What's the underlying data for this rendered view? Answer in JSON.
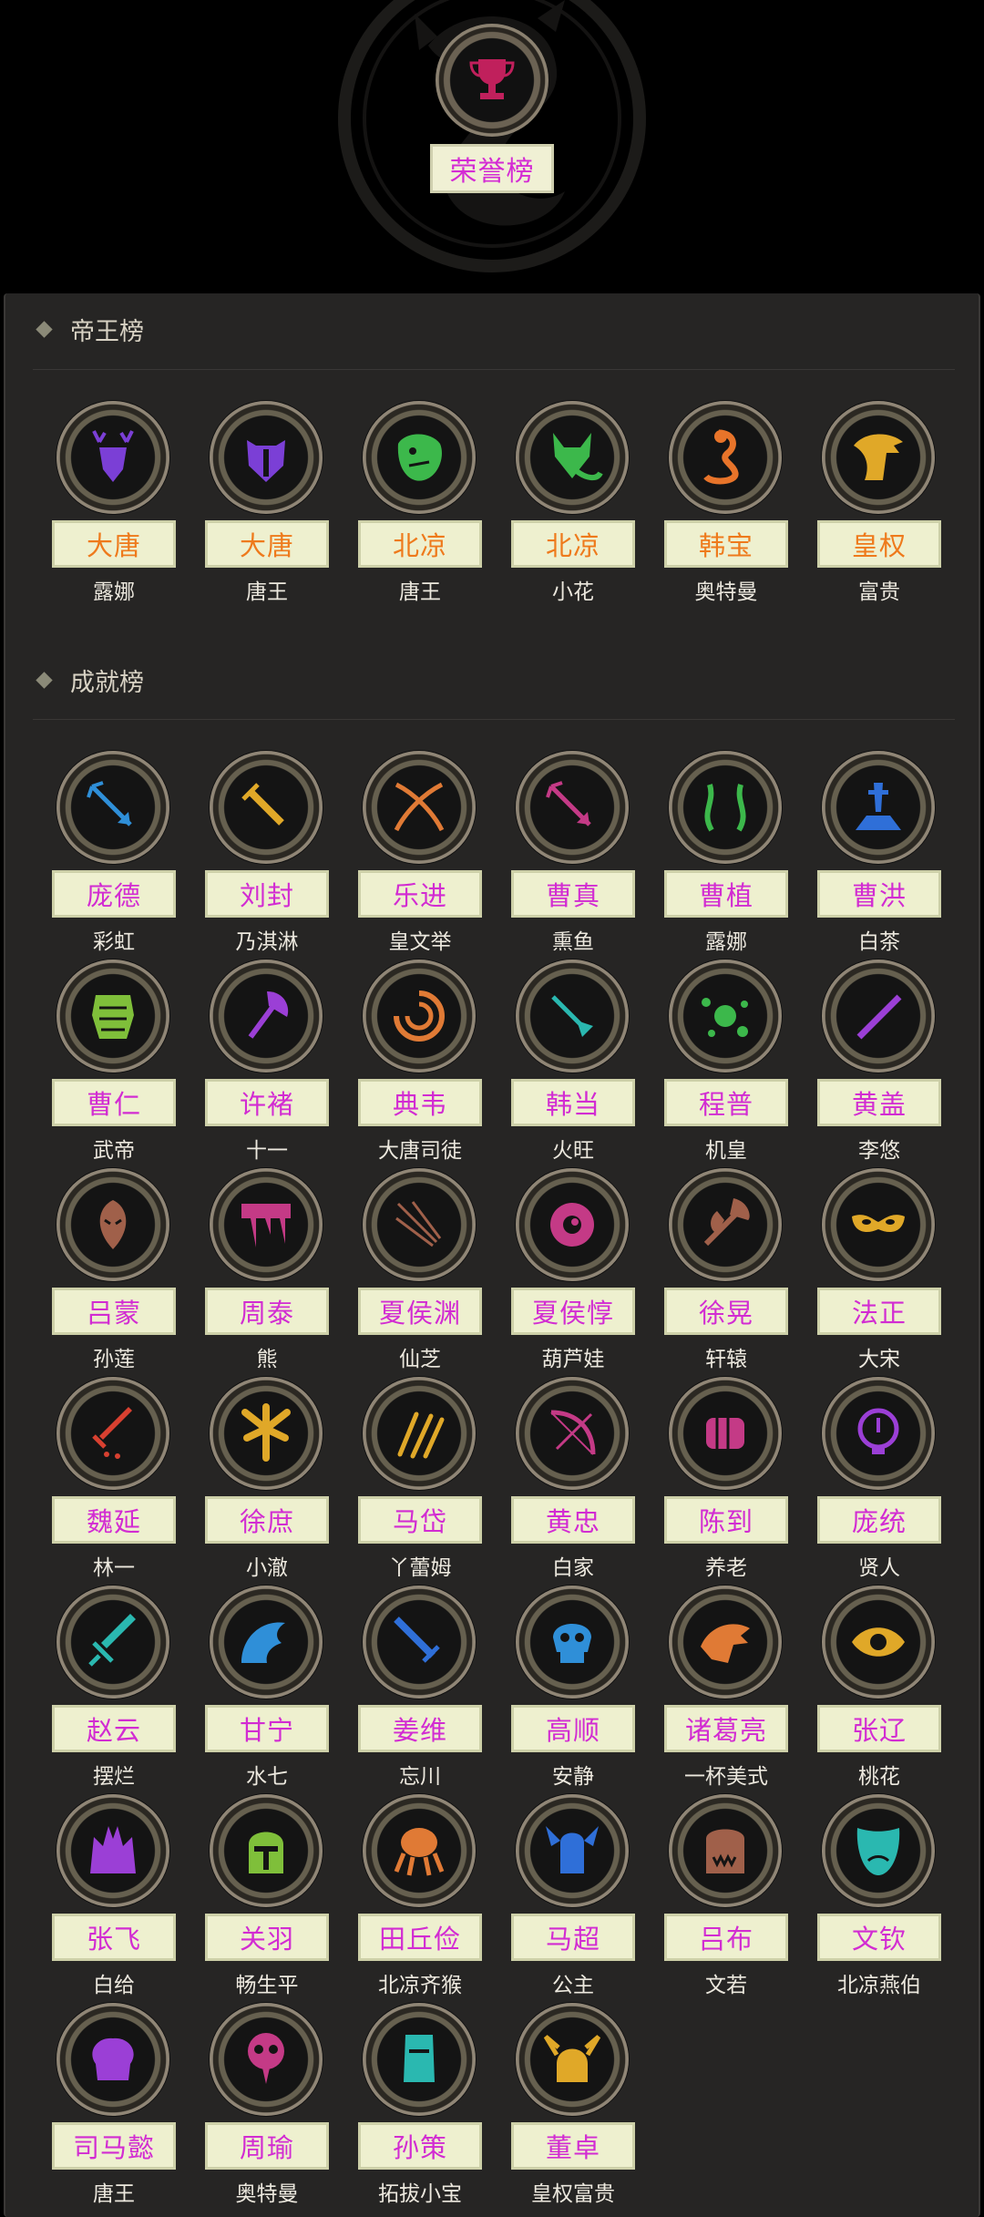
{
  "header": {
    "title": "荣誉榜",
    "icon": "trophy-icon",
    "accent": "#d42bd4"
  },
  "emperor": {
    "title": "帝王榜",
    "items": [
      {
        "faction": "大唐",
        "player": "露娜",
        "icon": "deer-icon",
        "color": "#7b3fd6"
      },
      {
        "faction": "大唐",
        "player": "唐王",
        "icon": "badger-icon",
        "color": "#7b3fd6"
      },
      {
        "faction": "北凉",
        "player": "唐王",
        "icon": "lizard-icon",
        "color": "#3cb84b"
      },
      {
        "faction": "北凉",
        "player": "小花",
        "icon": "fox-icon",
        "color": "#3cb84b"
      },
      {
        "faction": "韩宝",
        "player": "奥特曼",
        "icon": "cobra-icon",
        "color": "#e8742a"
      },
      {
        "faction": "皇权",
        "player": "富贵",
        "icon": "eagle-icon",
        "color": "#e0a828"
      }
    ]
  },
  "achievement": {
    "title": "成就榜",
    "items": [
      {
        "name": "庞德",
        "player": "彩虹",
        "icon": "arrow-icon",
        "color": "#2f8fd8"
      },
      {
        "name": "刘封",
        "player": "乃淇淋",
        "icon": "dagger-icon",
        "color": "#e0a828"
      },
      {
        "name": "乐进",
        "player": "皇文举",
        "icon": "crossed-scimitars-icon",
        "color": "#e07a35"
      },
      {
        "name": "曹真",
        "player": "熏鱼",
        "icon": "arrow-icon",
        "color": "#c43a86"
      },
      {
        "name": "曹植",
        "player": "露娜",
        "icon": "serpents-icon",
        "color": "#3cb84b"
      },
      {
        "name": "曹洪",
        "player": "白茶",
        "icon": "sword-in-stone-icon",
        "color": "#2f6fd8"
      },
      {
        "name": "曹仁",
        "player": "武帝",
        "icon": "armor-icon",
        "color": "#7fbf3a"
      },
      {
        "name": "许褚",
        "player": "十一",
        "icon": "axe-icon",
        "color": "#9b3fd6"
      },
      {
        "name": "典韦",
        "player": "大唐司徒",
        "icon": "vortex-icon",
        "color": "#e07a35"
      },
      {
        "name": "韩当",
        "player": "火旺",
        "icon": "shovel-icon",
        "color": "#2ab8b0"
      },
      {
        "name": "程普",
        "player": "机皇",
        "icon": "splash-icon",
        "color": "#3cb84b"
      },
      {
        "name": "黄盖",
        "player": "李悠",
        "icon": "staff-icon",
        "color": "#9b3fd6"
      },
      {
        "name": "吕蒙",
        "player": "孙莲",
        "icon": "mask-icon",
        "color": "#a0604a"
      },
      {
        "name": "周泰",
        "player": "熊",
        "icon": "drip-icon",
        "color": "#c43a86"
      },
      {
        "name": "夏侯渊",
        "player": "仙芝",
        "icon": "arrow-burst-icon",
        "color": "#a0604a"
      },
      {
        "name": "夏侯惇",
        "player": "葫芦娃",
        "icon": "eyeball-icon",
        "color": "#c43a86"
      },
      {
        "name": "徐晃",
        "player": "轩辕",
        "icon": "battle-axe-icon",
        "color": "#a0604a"
      },
      {
        "name": "法正",
        "player": "大宋",
        "icon": "carnival-mask-icon",
        "color": "#e0a828"
      },
      {
        "name": "魏延",
        "player": "林一",
        "icon": "bloody-sword-icon",
        "color": "#d84030"
      },
      {
        "name": "徐庶",
        "player": "小澈",
        "icon": "leaf-icon",
        "color": "#e0a828"
      },
      {
        "name": "马岱",
        "player": "丫蕾姆",
        "icon": "claws-icon",
        "color": "#e0a828"
      },
      {
        "name": "黄忠",
        "player": "白家",
        "icon": "bow-icon",
        "color": "#c43a86"
      },
      {
        "name": "陈到",
        "player": "养老",
        "icon": "fist-icon",
        "color": "#c43a86"
      },
      {
        "name": "庞统",
        "player": "贤人",
        "icon": "idea-icon",
        "color": "#9b3fd6"
      },
      {
        "name": "赵云",
        "player": "摆烂",
        "icon": "crystal-sword-icon",
        "color": "#2ab8b0"
      },
      {
        "name": "甘宁",
        "player": "水七",
        "icon": "wave-icon",
        "color": "#2f8fd8"
      },
      {
        "name": "姜维",
        "player": "忘川",
        "icon": "sword-icon",
        "color": "#2f6fd8"
      },
      {
        "name": "高顺",
        "player": "安静",
        "icon": "skull-icon",
        "color": "#2f8fd8"
      },
      {
        "name": "诸葛亮",
        "player": "一杯美式",
        "icon": "dragon-icon",
        "color": "#e07a35"
      },
      {
        "name": "张辽",
        "player": "桃花",
        "icon": "eye-icon",
        "color": "#e0a828"
      },
      {
        "name": "张飞",
        "player": "白给",
        "icon": "demon-icon",
        "color": "#9b3fd6"
      },
      {
        "name": "关羽",
        "player": "畅生平",
        "icon": "helmet-icon",
        "color": "#7fbf3a"
      },
      {
        "name": "田丘俭",
        "player": "北凉齐猴",
        "icon": "octopus-icon",
        "color": "#e07a35"
      },
      {
        "name": "马超",
        "player": "公主",
        "icon": "winged-helmet-icon",
        "color": "#2f6fd8"
      },
      {
        "name": "吕布",
        "player": "文若",
        "icon": "monster-icon",
        "color": "#a0604a"
      },
      {
        "name": "文钦",
        "player": "北凉燕伯",
        "icon": "theater-mask-icon",
        "color": "#2ab8b0"
      },
      {
        "name": "司马懿",
        "player": "唐王",
        "icon": "brain-icon",
        "color": "#9b3fd6"
      },
      {
        "name": "周瑜",
        "player": "奥特曼",
        "icon": "plague-mask-icon",
        "color": "#c43a86"
      },
      {
        "name": "孙策",
        "player": "拓拔小宝",
        "icon": "moai-icon",
        "color": "#2ab8b0"
      },
      {
        "name": "董卓",
        "player": "皇权富贵",
        "icon": "viking-icon",
        "color": "#e0a828"
      }
    ]
  }
}
